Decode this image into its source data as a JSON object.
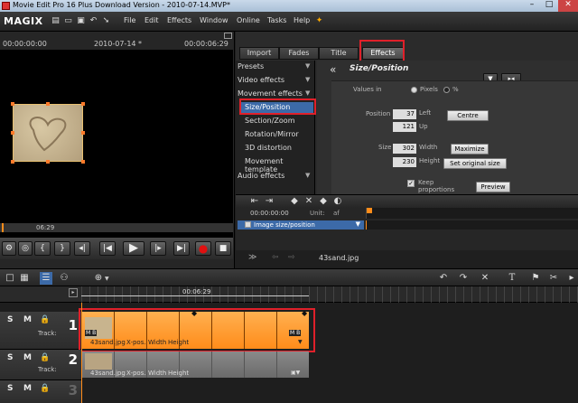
{
  "window": {
    "title": "Movie Edit Pro 16 Plus Download Version - 2010-07-14.MVP*",
    "minimize": "–",
    "maximize": "□",
    "close": "✕"
  },
  "menubar": {
    "logo": "MAGIX",
    "items": [
      "File",
      "Edit",
      "Effects",
      "Window",
      "Online",
      "Tasks",
      "Help"
    ]
  },
  "monitor": {
    "time_start": "00:00:00:00",
    "project_name": "2010-07-14 *",
    "time_end": "00:00:06:29",
    "scrub_time": "06:29"
  },
  "effects": {
    "tabs": [
      "Import",
      "Fades",
      "Title",
      "Effects"
    ],
    "active_tab": "Effects",
    "categories": [
      {
        "label": "Presets",
        "sub": false
      },
      {
        "label": "Video effects",
        "sub": false
      },
      {
        "label": "Movement effects",
        "sub": false
      },
      {
        "label": "Size/Position",
        "sub": true,
        "selected": true
      },
      {
        "label": "Section/Zoom",
        "sub": true
      },
      {
        "label": "Rotation/Mirror",
        "sub": true
      },
      {
        "label": "3D distortion",
        "sub": true
      },
      {
        "label": "Movement template",
        "sub": true
      },
      {
        "label": "Audio effects",
        "sub": false
      }
    ],
    "panel_title": "Size/Position",
    "back_symbol": "«",
    "values_in_label": "Values in",
    "unit_pixels": "Pixels",
    "unit_percent": "%",
    "position_label": "Position",
    "position_left": "37",
    "left_label": "Left",
    "position_up": "121",
    "up_label": "Up",
    "centre_button": "Centre",
    "size_label": "Size",
    "size_width": "302",
    "width_label": "Width",
    "size_height": "230",
    "height_label": "Height",
    "maximize_button": "Maximize",
    "original_size_button": "Set original size",
    "keep_proportions_label": "Keep proportions",
    "preview_button": "Preview"
  },
  "keyframes": {
    "time": "00:00:00:00",
    "unit_label": "Unit:",
    "unit_value": "af",
    "track_label": "Image size/position"
  },
  "clipbar": {
    "filename": "43sand.jpg"
  },
  "timeline": {
    "ruler_time": "00:06:29",
    "tracks": [
      {
        "number": "1",
        "label": "Track:"
      },
      {
        "number": "2",
        "label": "Track:"
      },
      {
        "number": "3",
        "label": ""
      }
    ],
    "clip_name": "43sand.jpg",
    "clip_params": [
      "X-pos.",
      "Width",
      "Height"
    ],
    "badge_mb": "M B"
  },
  "colors": {
    "accent_orange": "#ff8c1a",
    "highlight_red": "#e0202a",
    "selection_blue": "#3c6aa8"
  }
}
